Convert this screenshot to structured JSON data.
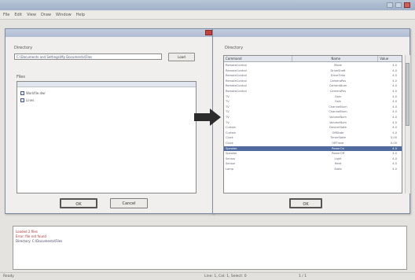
{
  "app": {
    "menu": [
      "File",
      "Edit",
      "View",
      "Draw",
      "Window",
      "Help"
    ]
  },
  "left_dialog": {
    "directory_label": "Directory",
    "directory_value": "C:\\Documents and Settings\\My Documents\\Files",
    "browse_label": "Load",
    "files_label": "Files",
    "files": [
      "Workfile.dwr",
      "Lines"
    ],
    "ok_label": "OK",
    "cancel_label": "Cancel"
  },
  "right_dialog": {
    "directory_label": "Directory",
    "columns": [
      "Command",
      "Name",
      "Value"
    ],
    "rows": [
      [
        "RemoteControl",
        "Mode",
        "4.0"
      ],
      [
        "RemoteControl",
        "DriveShaft",
        "4.0"
      ],
      [
        "RemoteControl",
        "DriveTime",
        "4.0"
      ],
      [
        "RemoteControl",
        "CameraPos",
        "4.0"
      ],
      [
        "RemoteControl",
        "CameraNum",
        "4.0"
      ],
      [
        "RemoteControl",
        "CameraPos",
        "4.0"
      ],
      [
        "TV",
        "Gain",
        "4.0"
      ],
      [
        "TV",
        "Gain",
        "4.0"
      ],
      [
        "TV",
        "ChannelNum",
        "4.0"
      ],
      [
        "TV",
        "ChannelNum",
        "4.0"
      ],
      [
        "TV",
        "VolumeNum",
        "4.0"
      ],
      [
        "TV",
        "VolumeNum",
        "4.0"
      ],
      [
        "Curtain",
        "DeviceState",
        "4.0"
      ],
      [
        "Curtain",
        "OffState",
        "4.0"
      ],
      [
        "Clock",
        "TimerState",
        "0.00"
      ],
      [
        "Clock",
        "OffTimer",
        "0.00"
      ],
      [
        "Speaker",
        "PowerOn",
        "4.0"
      ],
      [
        "Speaker",
        "PowerOff",
        "4.0"
      ],
      [
        "Sensor",
        "Light",
        "4.0"
      ],
      [
        "Sensor",
        "Heat",
        "4.0"
      ],
      [
        "Lamp",
        "State",
        "4.0"
      ]
    ],
    "ok_label": "OK"
  },
  "output": {
    "lines": [
      "Loaded 2 files",
      "Error: file not found",
      "Directory: C:\\Documents\\Files"
    ]
  },
  "status": {
    "left": "Ready",
    "middle": "Line: 1, Col: 1, Select: 0",
    "right": "1 / 1"
  },
  "colors": {
    "selection": "#4f6a9c",
    "title_gradient": "#aebbd2",
    "arrow": "#2c2c2c",
    "close": "#c9413c"
  }
}
